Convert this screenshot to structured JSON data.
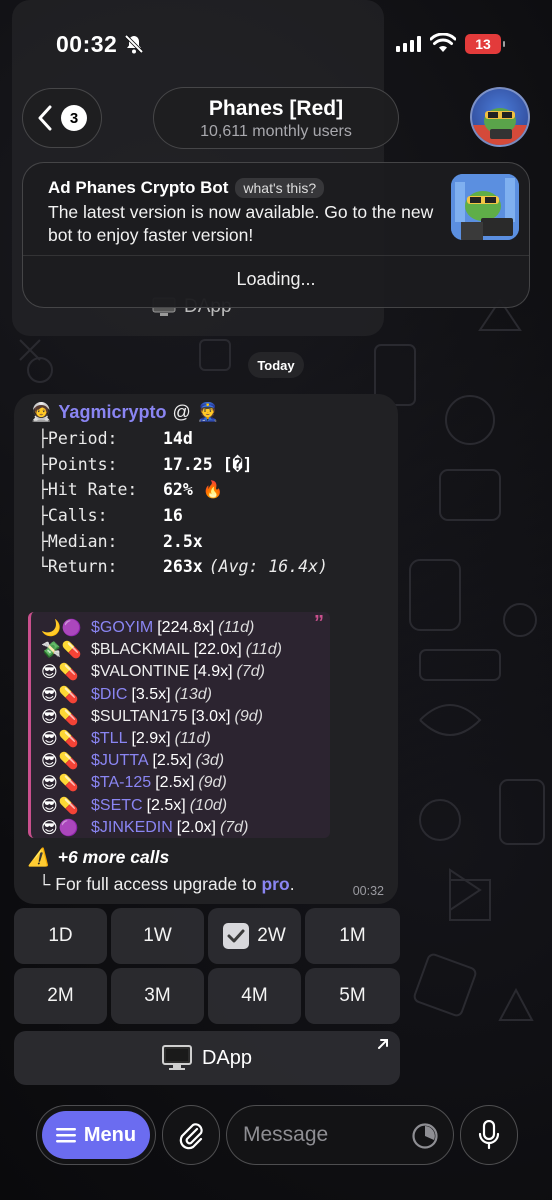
{
  "status_bar": {
    "time": "00:32",
    "battery": "13"
  },
  "header": {
    "back_count": "3",
    "title": "Phanes [Red]",
    "subtitle": "10,611 monthly users"
  },
  "ad": {
    "title": "Ad Phanes Crypto Bot",
    "badge": "what's this?",
    "text": "The latest version is now available. Go to the new bot to enjoy faster version!",
    "action": "Loading..."
  },
  "previous_message": {
    "dapp_label": "DApp"
  },
  "date_separator": "Today",
  "message": {
    "sender": "Yagmicrypto",
    "sender_suffix": "@",
    "stats": [
      {
        "label": "├Period:",
        "value": "14d",
        "extra": ""
      },
      {
        "label": "├Points:",
        "value": "17.25 [�]",
        "extra": ""
      },
      {
        "label": "├Hit Rate:",
        "value": "62% 🔥",
        "extra": ""
      },
      {
        "label": "├Calls:",
        "value": "16",
        "extra": ""
      },
      {
        "label": "├Median:",
        "value": "2.5x",
        "extra": ""
      },
      {
        "label": "└Return:",
        "value": "263x",
        "extra": "(Avg: 16.4x)"
      }
    ],
    "calls": [
      {
        "emoji": "🌙🟣",
        "ticker": "$GOYIM",
        "link": true,
        "mult": "[224.8x]",
        "age": "(11d)"
      },
      {
        "emoji": "💸💊",
        "ticker": "$BLACKMAIL",
        "link": false,
        "mult": "[22.0x]",
        "age": "(11d)"
      },
      {
        "emoji": "😎💊",
        "ticker": "$VALONTINE",
        "link": false,
        "mult": "[4.9x]",
        "age": "(7d)"
      },
      {
        "emoji": "😎💊",
        "ticker": "$DIC",
        "link": true,
        "mult": "[3.5x]",
        "age": "(13d)"
      },
      {
        "emoji": "😎💊",
        "ticker": "$SULTAN175",
        "link": false,
        "mult": "[3.0x]",
        "age": "(9d)"
      },
      {
        "emoji": "😎💊",
        "ticker": "$TLL",
        "link": true,
        "mult": "[2.9x]",
        "age": "(11d)"
      },
      {
        "emoji": "😎💊",
        "ticker": "$JUTTA",
        "link": true,
        "mult": "[2.5x]",
        "age": "(3d)"
      },
      {
        "emoji": "😎💊",
        "ticker": "$TA-125",
        "link": true,
        "mult": "[2.5x]",
        "age": "(9d)"
      },
      {
        "emoji": "😎💊",
        "ticker": "$SETC",
        "link": true,
        "mult": "[2.5x]",
        "age": "(10d)"
      },
      {
        "emoji": "😎🟣",
        "ticker": "$JINKEDIN",
        "link": true,
        "mult": "[2.0x]",
        "age": "(7d)"
      }
    ],
    "more_calls": "+6 more calls",
    "upgrade_prefix": "└ For full access upgrade to ",
    "upgrade_link": "pro",
    "upgrade_suffix": ".",
    "time": "00:32"
  },
  "keyboard": {
    "row1": [
      "1D",
      "1W",
      "2W",
      "1M"
    ],
    "row2": [
      "2M",
      "3M",
      "4M",
      "5M"
    ],
    "selected": "2W",
    "dapp": "DApp"
  },
  "composer": {
    "menu_label": "Menu",
    "placeholder": "Message"
  },
  "colors": {
    "accent": "#8a85f2",
    "menu_button": "#6b6cf0",
    "quote_bar": "#c9508d",
    "battery": "#e33b3b"
  }
}
